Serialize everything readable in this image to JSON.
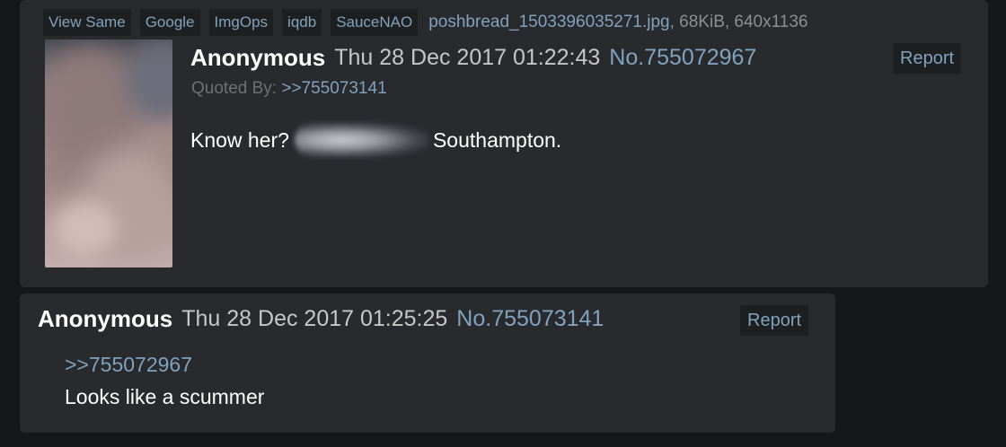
{
  "op_post": {
    "file_bar": {
      "buttons": [
        "View Same",
        "Google",
        "ImgOps",
        "iqdb",
        "SauceNAO"
      ],
      "filename": "poshbread_1503396035271.jpg",
      "file_meta": ", 68KiB, 640x1136"
    },
    "name": "Anonymous",
    "date": "Thu 28 Dec 2017 01:22:43",
    "post_number": "No.755072967",
    "report_label": "Report",
    "quoted_by_label": "Quoted By: ",
    "quoted_by_link": ">>755073141",
    "message_before": "Know her?",
    "message_after": "Southampton."
  },
  "reply_post": {
    "name": "Anonymous",
    "date": "Thu 28 Dec 2017 01:25:25",
    "post_number": "No.755073141",
    "report_label": "Report",
    "quote_link": ">>755072967",
    "message": "Looks like a scummer"
  },
  "colors": {
    "background": "#16171b",
    "post_background": "#282a2e",
    "link": "#81a2be",
    "text": "#ffffff",
    "date": "#c5c8c6"
  }
}
